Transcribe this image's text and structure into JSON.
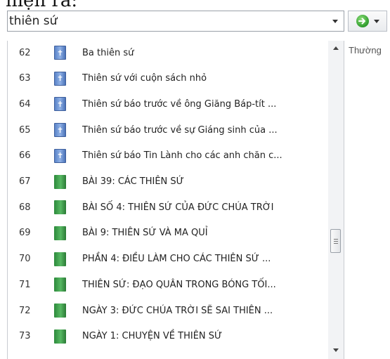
{
  "header": {
    "text": "hiện ra:"
  },
  "search": {
    "value": "thiên sứ",
    "placeholder": ""
  },
  "side_label": "Thường",
  "results": [
    {
      "num": "62",
      "title": "Ba thiên sứ",
      "icon": "bible-icon"
    },
    {
      "num": "63",
      "title": "Thiên sứ với cuộn sách nhỏ",
      "icon": "bible-icon"
    },
    {
      "num": "64",
      "title": "Thiên sứ báo trước về ông Giăng Báp-tít ...",
      "icon": "bible-icon"
    },
    {
      "num": "65",
      "title": "Thiên sứ báo trước về sự Giáng sinh của ...",
      "icon": "bible-icon"
    },
    {
      "num": "66",
      "title": "Thiên sứ báo Tin Lành cho các anh chăn c...",
      "icon": "bible-icon"
    },
    {
      "num": "67",
      "title": "BÀI 39: CÁC THIÊN SỨ",
      "icon": "book-icon"
    },
    {
      "num": "68",
      "title": "BÀI SỐ 4: THIÊN SỨ CỦA ĐỨC CHÚA TRỜI",
      "icon": "book-icon"
    },
    {
      "num": "69",
      "title": "BÀI 9: THIÊN SỨ VÀ MA QUỈ",
      "icon": "book-icon"
    },
    {
      "num": "70",
      "title": "PHẦN 4: ĐIỀU LÀM CHO CÁC THIÊN SỨ ...",
      "icon": "book-icon"
    },
    {
      "num": "71",
      "title": "THIÊN SỨ: ĐẠO QUÂN TRONG BÓNG TỐI...",
      "icon": "book-icon"
    },
    {
      "num": "72",
      "title": "NGÀY 3: ĐỨC CHÚA TRỜI SẼ SAI THIÊN ...",
      "icon": "book-icon"
    },
    {
      "num": "73",
      "title": "NGÀY 1: CHUYỆN VỀ THIÊN SỨ",
      "icon": "book-icon"
    }
  ]
}
